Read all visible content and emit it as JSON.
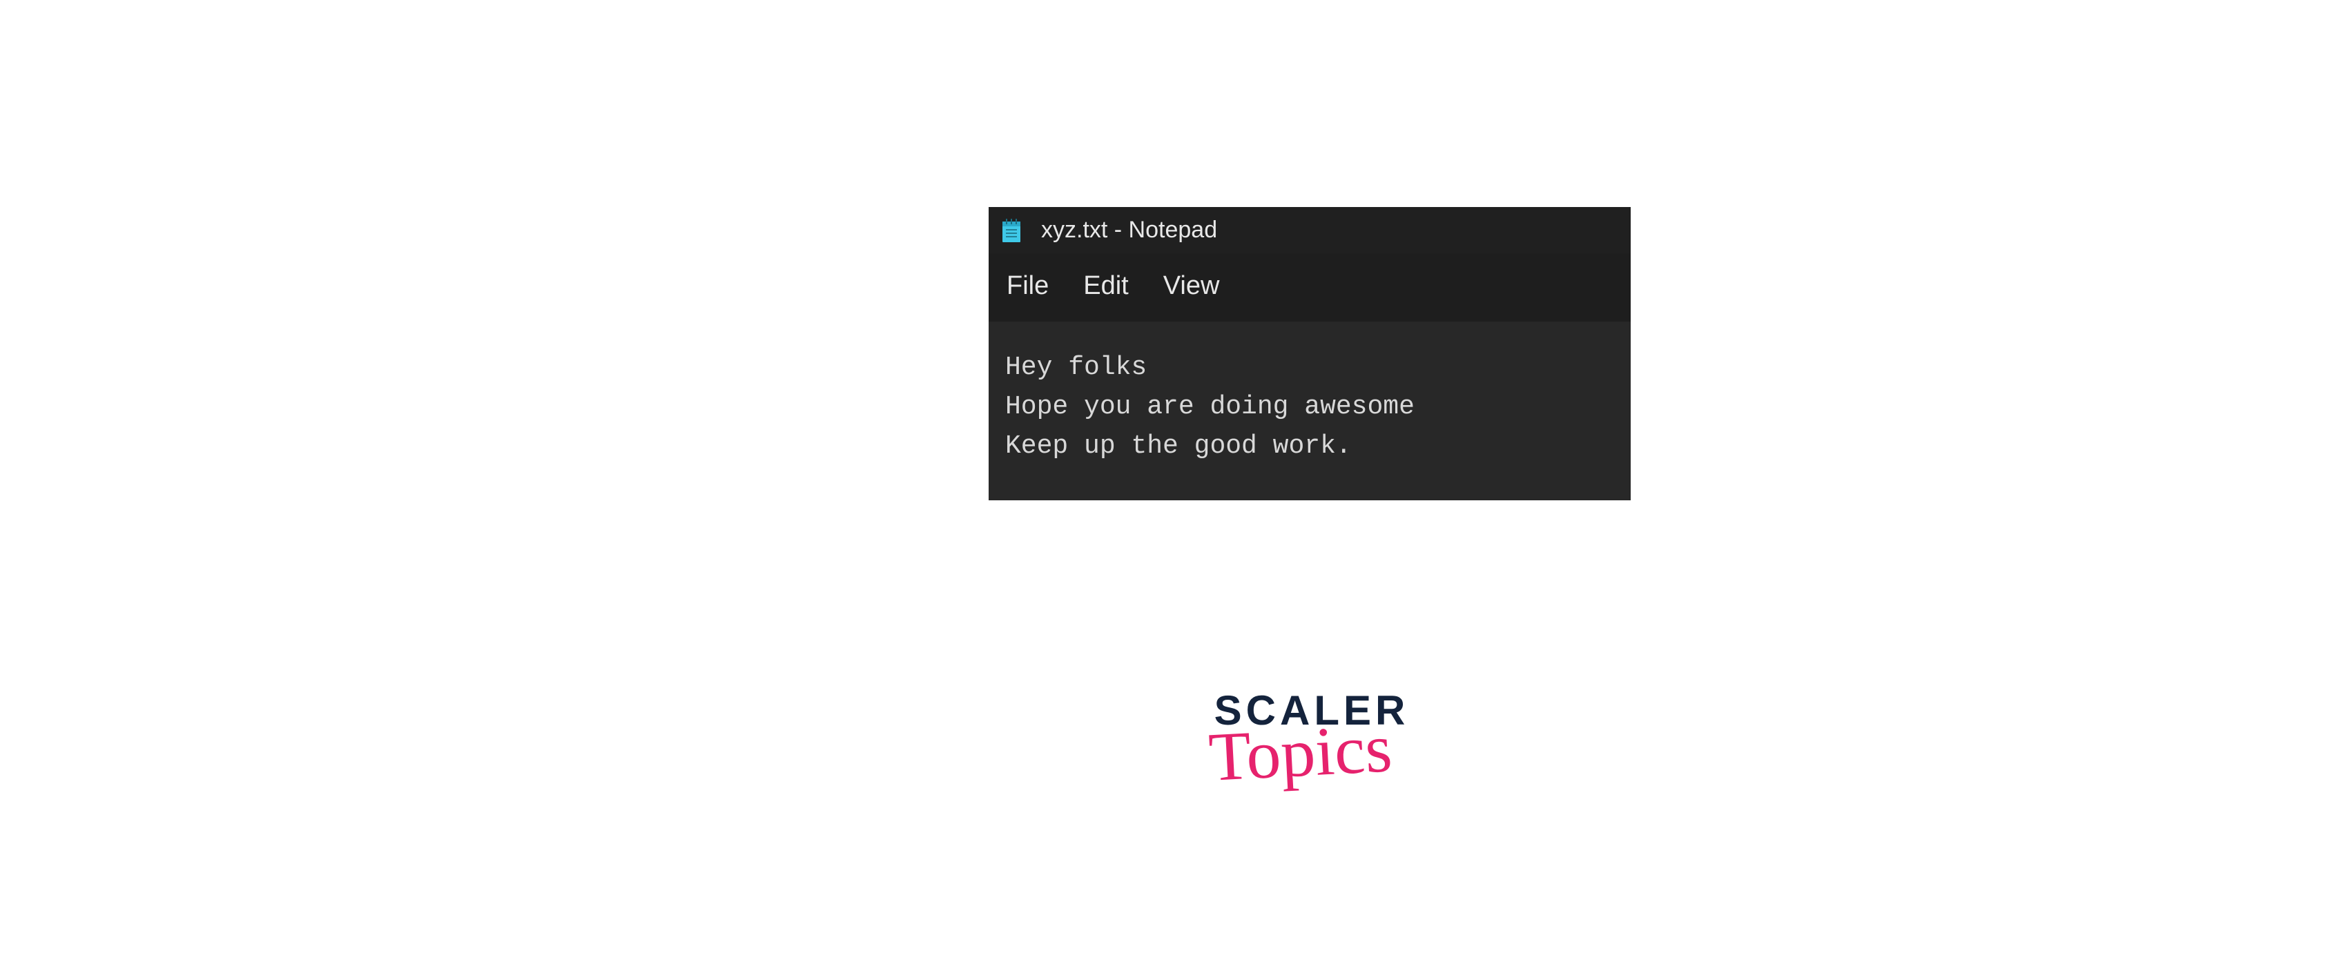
{
  "notepad": {
    "title": "xyz.txt - Notepad",
    "menu": {
      "file": "File",
      "edit": "Edit",
      "view": "View"
    },
    "content": "Hey folks\nHope you are doing awesome\nKeep up the good work."
  },
  "branding": {
    "line1": "SCALER",
    "line2": "Topics"
  }
}
